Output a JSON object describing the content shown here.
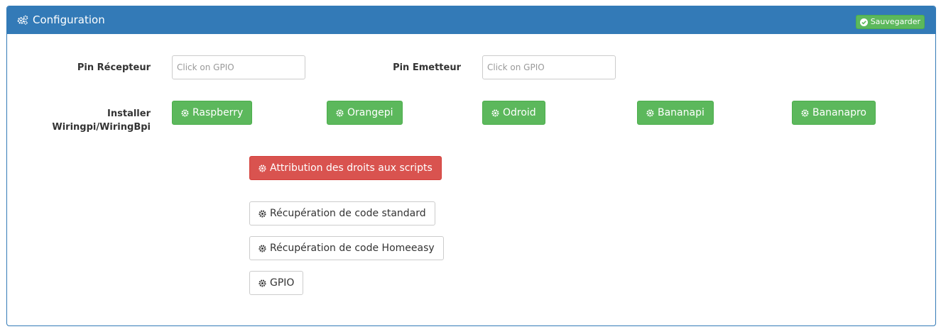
{
  "panel": {
    "title": "Configuration",
    "save_label": "Sauvegarder"
  },
  "pins": {
    "receiver_label": "Pin Récepteur",
    "receiver_placeholder": "Click on GPIO",
    "emitter_label": "Pin Emetteur",
    "emitter_placeholder": "Click on GPIO"
  },
  "install": {
    "label_line1": "Installer",
    "label_line2": "Wiringpi/WiringBpi",
    "buttons": [
      "Raspberry",
      "Orangepi",
      "Odroid",
      "Bananapi",
      "Bananapro"
    ]
  },
  "actions": {
    "rights_label": "Attribution des droits aux scripts",
    "standard_label": "Récupération de code standard",
    "homeeasy_label": "Récupération de code Homeeasy",
    "gpio_label": "GPIO"
  },
  "colors": {
    "primary": "#337ab7",
    "success": "#5cb85c",
    "danger": "#d9534f"
  },
  "icons": {
    "title": "cogs-icon",
    "save": "check-circle-icon",
    "buttons": "gear-icon"
  }
}
